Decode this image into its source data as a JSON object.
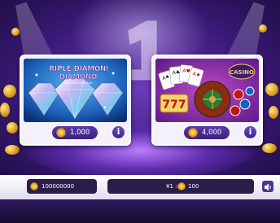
{
  "games": [
    {
      "title": "TRIPLE DIAMOND",
      "subtitle": "Triple Diamond Slot",
      "price": "1,000",
      "info_label": "i"
    },
    {
      "title": "CASINO",
      "subtitle": "",
      "price": "4,000",
      "info_label": "i"
    }
  ],
  "footer": {
    "balance": "100000000",
    "bet_label": "¥1 :",
    "bet_value": "100"
  },
  "colors": {
    "background": "#3a1a78",
    "card": "#f4f1fb",
    "button": "#4a2e98",
    "coin": "#e0a72a"
  }
}
